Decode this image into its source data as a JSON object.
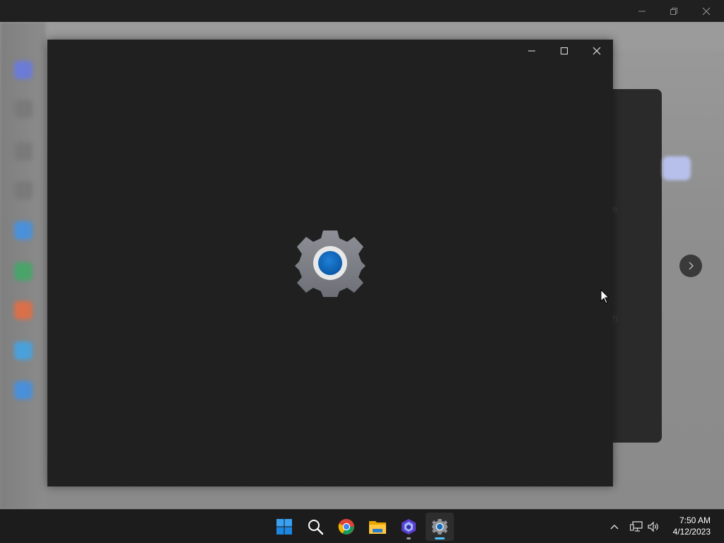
{
  "host_window": {
    "controls": {
      "minimize_icon": "minimize-icon",
      "restore_icon": "restore-icon",
      "close_icon": "close-icon"
    }
  },
  "background_app": {
    "fragment_top": "e",
    "fragment_bottom": "h",
    "next_icon": "chevron-right-icon"
  },
  "settings_window": {
    "splash_icon": "settings-gear-icon",
    "controls": {
      "minimize_icon": "minimize-icon",
      "maximize_icon": "maximize-icon",
      "close_icon": "close-icon"
    }
  },
  "taskbar": {
    "apps": [
      {
        "name": "start",
        "icon": "windows-logo-icon"
      },
      {
        "name": "search",
        "icon": "search-icon"
      },
      {
        "name": "chrome",
        "icon": "chrome-icon"
      },
      {
        "name": "file-explorer",
        "icon": "folder-icon"
      },
      {
        "name": "app",
        "icon": "hexagon-app-icon"
      },
      {
        "name": "settings",
        "icon": "settings-gear-icon",
        "active": true
      }
    ],
    "tray": {
      "overflow_icon": "chevron-up-icon",
      "network_icon": "network-icon",
      "volume_icon": "speaker-icon"
    },
    "clock": {
      "time": "7:50 AM",
      "date": "4/12/2023"
    }
  },
  "colors": {
    "window_bg": "#202020",
    "taskbar_bg": "#1c1c1c",
    "accent": "#0f6cbd",
    "gear_gray": "#7a7e84"
  }
}
